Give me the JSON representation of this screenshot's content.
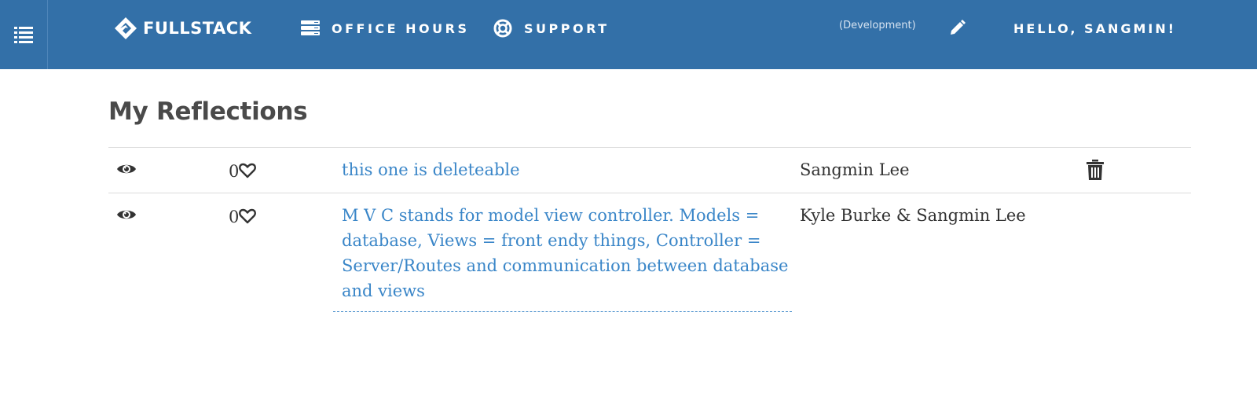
{
  "nav": {
    "brand": "FULLSTACK",
    "links": [
      {
        "label": "OFFICE HOURS",
        "icon": "server-icon"
      },
      {
        "label": "SUPPORT",
        "icon": "life-ring-icon"
      }
    ],
    "environment": "(Development)",
    "greeting": "HELLO, SANGMIN!"
  },
  "page": {
    "title": "My Reflections"
  },
  "reflections": [
    {
      "likes": "0",
      "title": "this one is deleteable",
      "author": "Sangmin Lee",
      "deletable": true
    },
    {
      "likes": "0",
      "title": "M V C stands for model view controller. Models = database, Views = front endy things, Controller = Server/Routes and communication between database and views",
      "author": "Kyle Burke & Sangmin Lee",
      "deletable": false
    }
  ],
  "colors": {
    "header": "#3370a8",
    "link": "#3a86c8",
    "text": "#333333"
  }
}
